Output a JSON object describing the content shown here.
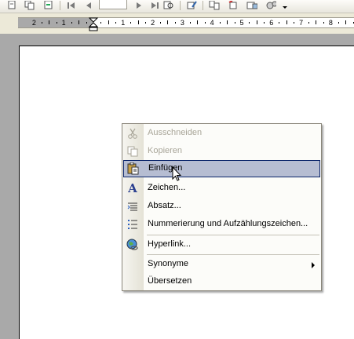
{
  "toolbar": {
    "buttons": [
      "new-doc-icon",
      "copy-doc-icon",
      "nav-back-icon",
      "first-page-icon",
      "prev-page-icon",
      "next-page-icon",
      "last-page-icon",
      "find-icon",
      "edit-icon",
      "compare-icon",
      "insert-icon",
      "track-changes-icon",
      "settings-icon"
    ],
    "page_value": ""
  },
  "ruler": {
    "left_labels": [
      "2",
      "1"
    ],
    "labels": [
      "1",
      "2",
      "3",
      "4",
      "5",
      "6",
      "7",
      "8"
    ]
  },
  "context_menu": {
    "items": [
      {
        "label": "Ausschneiden",
        "icon": "cut-icon",
        "enabled": false
      },
      {
        "label": "Kopieren",
        "icon": "copy-icon",
        "enabled": false
      },
      {
        "label": "Einfügen",
        "icon": "paste-icon",
        "enabled": true,
        "highlighted": true
      },
      {
        "label": "Zeichen...",
        "icon": "font-icon",
        "enabled": true
      },
      {
        "label": "Absatz...",
        "icon": "paragraph-icon",
        "enabled": true
      },
      {
        "label": "Nummerierung und Aufzählungszeichen...",
        "icon": "bullets-icon",
        "enabled": true
      },
      {
        "label": "Hyperlink...",
        "icon": "hyperlink-icon",
        "enabled": true
      },
      {
        "label": "Synonyme",
        "icon": "",
        "enabled": true,
        "submenu": true
      },
      {
        "label": "Übersetzen",
        "icon": "",
        "enabled": true
      }
    ]
  },
  "colors": {
    "highlight_bg": "#b6bdd2",
    "highlight_border": "#0a246a",
    "disabled_text": "#a8a598",
    "workspace": "#a9a9a9"
  }
}
